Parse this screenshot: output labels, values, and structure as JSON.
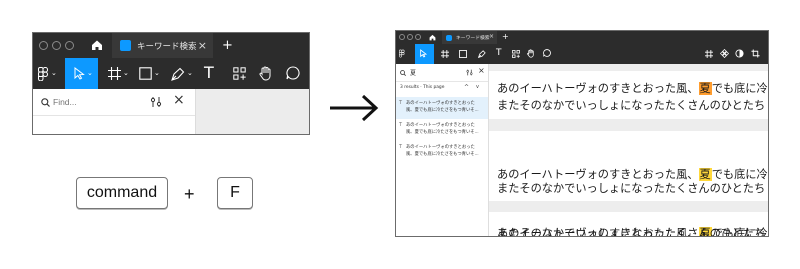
{
  "left_window": {
    "tab": {
      "label": "キーワード検索",
      "close": "×"
    },
    "new_tab": "+",
    "tools": {
      "text_tool": "T"
    },
    "find": {
      "placeholder": "Find...",
      "close": "×"
    }
  },
  "keys": {
    "modifier": "command",
    "plus": "+",
    "letter": "F"
  },
  "right_window": {
    "tab": {
      "label": "キーワード検索",
      "close": "×"
    },
    "new_tab": "+",
    "tools": {
      "text_tool": "T"
    },
    "search": {
      "query": "夏",
      "close": "×",
      "results_label": "3 results · This page",
      "prev": "^",
      "next": "v",
      "results": [
        {
          "line1": "あのイーハトーヴォのすきとおった",
          "line2": "風、夏でも底に冷たさをもつ青いそ..."
        },
        {
          "line1": "あのイーハトーヴォのすきとおった",
          "line2": "風、夏でも底に冷たさをもつ青いそ..."
        },
        {
          "line1": "あのイーハトーヴォのすきとおった",
          "line2": "風、夏でも底に冷たさをもつ青いそ..."
        }
      ]
    },
    "frames": [
      {
        "before": "あのイーハトーヴォのすきとおった風、",
        "match": "夏",
        "after": "でも底に冷",
        "line2": "またそのなかでいっしょになったたくさんのひとたち"
      },
      {
        "before": "あのイーハトーヴォのすきとおった風、",
        "match": "夏",
        "after": "でも底に冷",
        "line2": "またそのなかでいっしょになったたくさんのひとたち"
      },
      {
        "before": "あのイーハトーヴォのすきとおった風、",
        "match": "夏",
        "after": "でも底に冷",
        "line2": "またそのなかでいっしょになったたくさんのひとたち"
      }
    ]
  },
  "colors": {
    "toolbar_bg": "#2c2c2c",
    "accent": "#0d99ff",
    "current_match": "#ff9d2e",
    "other_match": "#ffd83b"
  }
}
